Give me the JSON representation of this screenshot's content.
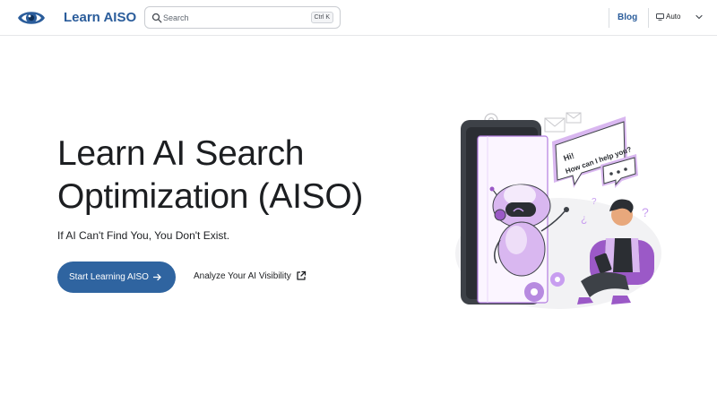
{
  "navbar": {
    "brand": "Learn AISO",
    "search": {
      "placeholder": "Search",
      "shortcut": "Ctrl K"
    },
    "links": {
      "blog": "Blog"
    },
    "theme_toggle": {
      "label": "Auto",
      "icon": "monitor-icon"
    }
  },
  "hero": {
    "title": "Learn AI Search Optimization (AISO)",
    "subtitle": "If AI Can't Find You, You Don't Exist.",
    "primary_cta": {
      "label": "Start Learning AISO",
      "icon": "arrow-right-icon"
    },
    "secondary_cta": {
      "label": "Analyze Your AI Visibility",
      "icon": "external-link-icon"
    }
  },
  "illustration": {
    "speech_bubble": {
      "line1": "Hi!",
      "line2": "How can I help you?"
    }
  },
  "colors": {
    "brand_blue": "#2b5d9b",
    "button_blue": "#2f64a0",
    "accent_purple": "#9b59c7",
    "light_purple": "#d9b7f0"
  }
}
